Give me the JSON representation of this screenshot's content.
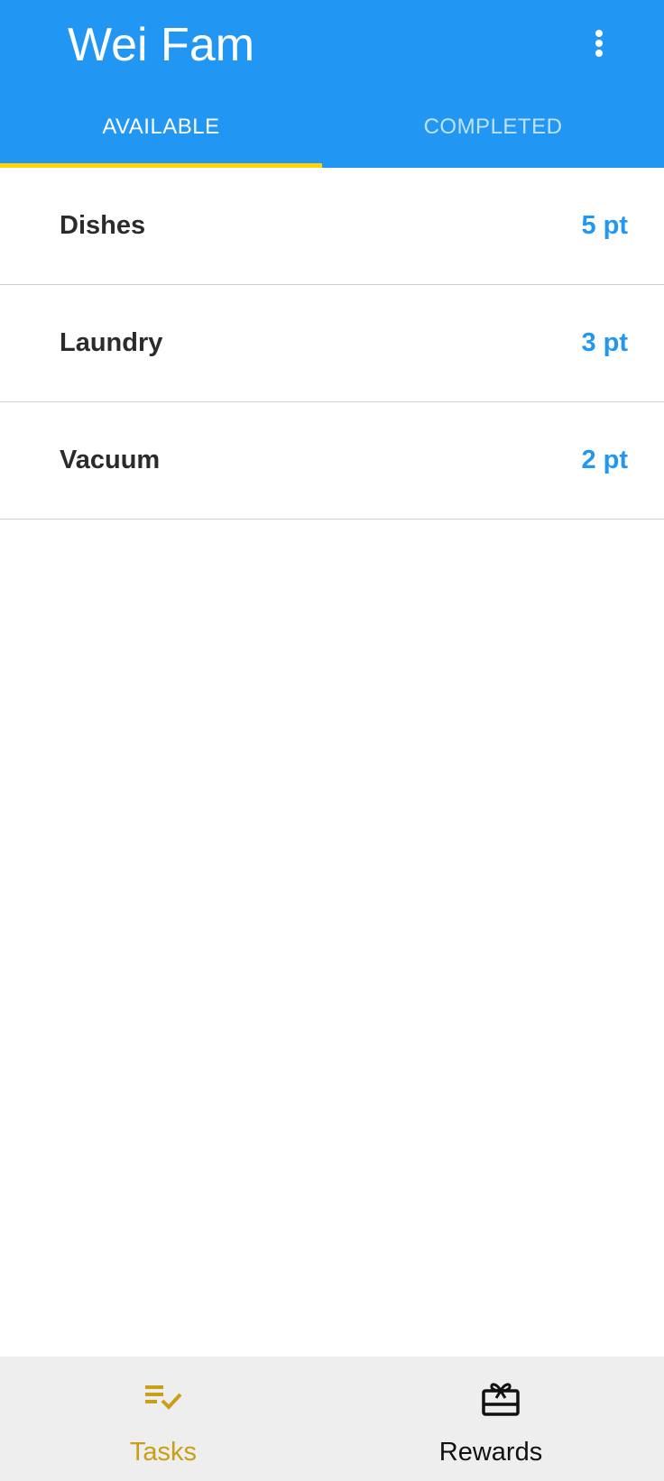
{
  "appbar": {
    "title": "Wei Fam",
    "menu_icon": "more-vertical-icon"
  },
  "tabs": [
    {
      "label": "AVAILABLE",
      "selected": true
    },
    {
      "label": "COMPLETED",
      "selected": false
    }
  ],
  "tasks": [
    {
      "name": "Dishes",
      "points": "5 pt"
    },
    {
      "name": "Laundry",
      "points": "3 pt"
    },
    {
      "name": "Vacuum",
      "points": "2 pt"
    }
  ],
  "bottom_nav": {
    "items": [
      {
        "label": "Tasks",
        "icon": "playlist-check-icon",
        "selected": true
      },
      {
        "label": "Rewards",
        "icon": "gift-card-icon",
        "selected": false
      }
    ]
  },
  "colors": {
    "primary": "#2196F3",
    "tab_indicator": "#FFD400",
    "nav_active": "#C9A015",
    "nav_background": "#EEEEEE",
    "points_text": "#2196F3"
  }
}
